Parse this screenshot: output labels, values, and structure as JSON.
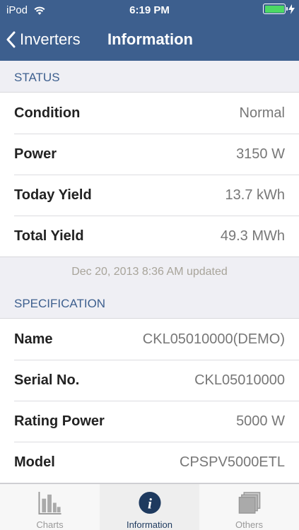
{
  "status_bar": {
    "carrier": "iPod",
    "time": "6:19 PM",
    "battery_level": 1.0,
    "battery_color": "#4cd964"
  },
  "nav": {
    "back_label": "Inverters",
    "title": "Information",
    "bar_color": "#3d5f8e"
  },
  "status_section": {
    "header": "STATUS",
    "rows": [
      {
        "label": "Condition",
        "value": "Normal"
      },
      {
        "label": "Power",
        "value": "3150 W"
      },
      {
        "label": "Today Yield",
        "value": "13.7 kWh"
      },
      {
        "label": "Total Yield",
        "value": "49.3 MWh"
      }
    ],
    "updated": "Dec 20, 2013 8:36 AM updated"
  },
  "spec_section": {
    "header": "SPECIFICATION",
    "rows": [
      {
        "label": "Name",
        "value": "CKL05010000(DEMO)"
      },
      {
        "label": "Serial No.",
        "value": "CKL05010000"
      },
      {
        "label": "Rating Power",
        "value": "5000 W"
      },
      {
        "label": "Model",
        "value": "CPSPV5000ETL"
      }
    ]
  },
  "tabbar": {
    "tabs": [
      {
        "label": "Charts",
        "icon": "bar-chart-icon",
        "active": false
      },
      {
        "label": "Information",
        "icon": "info-icon",
        "active": true
      },
      {
        "label": "Others",
        "icon": "stack-icon",
        "active": false
      }
    ]
  }
}
